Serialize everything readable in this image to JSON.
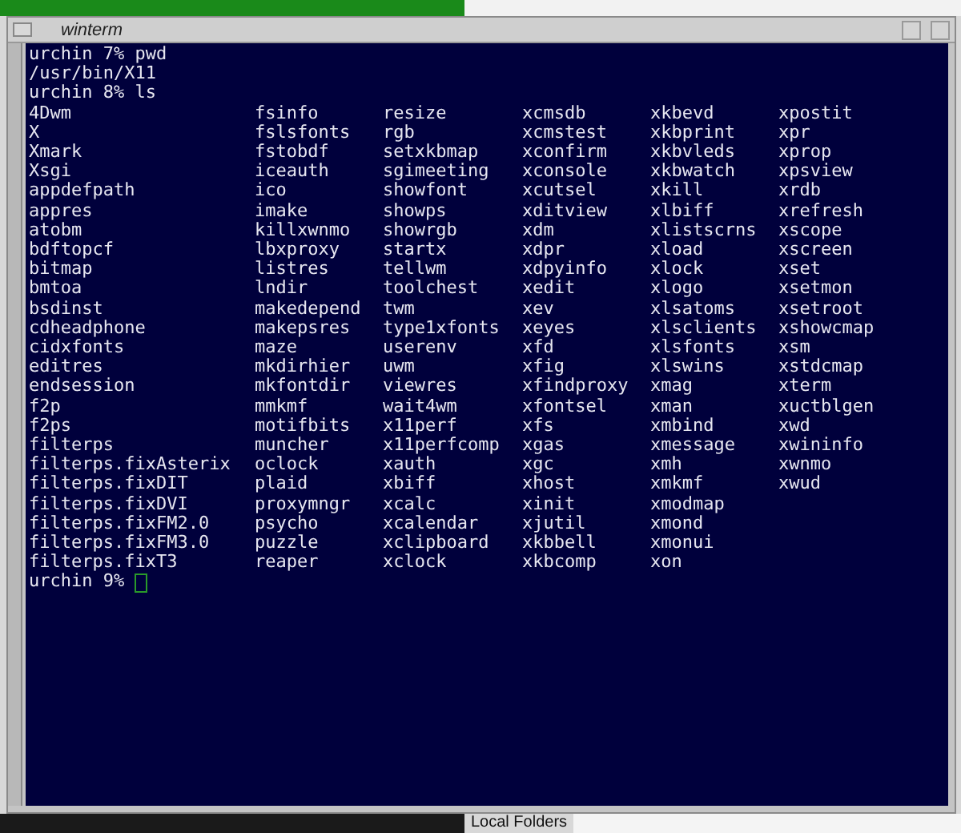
{
  "window": {
    "title": "winterm"
  },
  "terminal": {
    "lines": [
      "urchin 7% pwd",
      "/usr/bin/X11",
      "urchin 8% ls"
    ],
    "listing": [
      [
        "4Dwm",
        "X",
        "Xmark",
        "Xsgi",
        "appdefpath",
        "appres",
        "atobm",
        "bdftopcf",
        "bitmap",
        "bmtoa",
        "bsdinst",
        "cdheadphone",
        "cidxfonts",
        "editres",
        "endsession",
        "f2p",
        "f2ps",
        "filterps",
        "filterps.fixAsterix",
        "filterps.fixDIT",
        "filterps.fixDVI",
        "filterps.fixFM2.0",
        "filterps.fixFM3.0",
        "filterps.fixT3"
      ],
      [
        "fsinfo",
        "fslsfonts",
        "fstobdf",
        "iceauth",
        "ico",
        "imake",
        "killxwnmo",
        "lbxproxy",
        "listres",
        "lndir",
        "makedepend",
        "makepsres",
        "maze",
        "mkdirhier",
        "mkfontdir",
        "mmkmf",
        "motifbits",
        "muncher",
        "oclock",
        "plaid",
        "proxymngr",
        "psycho",
        "puzzle",
        "reaper"
      ],
      [
        "resize",
        "rgb",
        "setxkbmap",
        "sgimeeting",
        "showfont",
        "showps",
        "showrgb",
        "startx",
        "tellwm",
        "toolchest",
        "twm",
        "type1xfonts",
        "userenv",
        "uwm",
        "viewres",
        "wait4wm",
        "x11perf",
        "x11perfcomp",
        "xauth",
        "xbiff",
        "xcalc",
        "xcalendar",
        "xclipboard",
        "xclock"
      ],
      [
        "xcmsdb",
        "xcmstest",
        "xconfirm",
        "xconsole",
        "xcutsel",
        "xditview",
        "xdm",
        "xdpr",
        "xdpyinfo",
        "xedit",
        "xev",
        "xeyes",
        "xfd",
        "xfig",
        "xfindproxy",
        "xfontsel",
        "xfs",
        "xgas",
        "xgc",
        "xhost",
        "xinit",
        "xjutil",
        "xkbbell",
        "xkbcomp"
      ],
      [
        "xkbevd",
        "xkbprint",
        "xkbvleds",
        "xkbwatch",
        "xkill",
        "xlbiff",
        "xlistscrns",
        "xload",
        "xlock",
        "xlogo",
        "xlsatoms",
        "xlsclients",
        "xlsfonts",
        "xlswins",
        "xmag",
        "xman",
        "xmbind",
        "xmessage",
        "xmh",
        "xmkmf",
        "xmodmap",
        "xmond",
        "xmonui",
        "xon"
      ],
      [
        "xpostit",
        "xpr",
        "xprop",
        "xpsview",
        "xrdb",
        "xrefresh",
        "xscope",
        "xscreen",
        "xset",
        "xsetmon",
        "xsetroot",
        "xshowcmap",
        "xsm",
        "xstdcmap",
        "xterm",
        "xuctblgen",
        "xwd",
        "xwininfo",
        "xwnmo",
        "xwud"
      ]
    ],
    "prompt": "urchin 9%",
    "cursor": true
  },
  "background": {
    "folder_tab": "Local Folders"
  }
}
